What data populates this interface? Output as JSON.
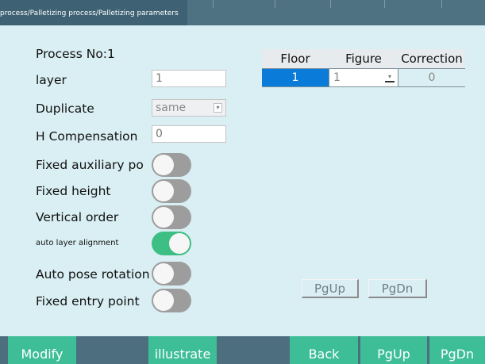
{
  "breadcrumb": "process/Palletizing process/Palletizing parameters",
  "process_no": "Process No:1",
  "fields": {
    "layer": {
      "label": "layer",
      "value": "1"
    },
    "duplicate": {
      "label": "Duplicate",
      "value": "same"
    },
    "h_compensation": {
      "label": "H Compensation",
      "value": "0"
    }
  },
  "toggles": [
    {
      "label": "Fixed auxiliary point",
      "on": false
    },
    {
      "label": "Fixed height",
      "on": false
    },
    {
      "label": "Vertical order",
      "on": false
    },
    {
      "label": "auto layer alignment",
      "on": true
    },
    {
      "label": "Auto pose rotation",
      "on": false
    },
    {
      "label": "Fixed entry point",
      "on": false
    }
  ],
  "table": {
    "headers": [
      "Floor",
      "Figure",
      "Correction"
    ],
    "row": {
      "floor": "1",
      "figure": "1",
      "correction": "0"
    }
  },
  "pager": {
    "pgup": "PgUp",
    "pgdn": "PgDn"
  },
  "bottom_buttons": {
    "modify": "Modify",
    "illustrate": "illustrate",
    "back": "Back",
    "pgup": "PgUp",
    "pgdn": "PgDn"
  },
  "colors": {
    "background": "#d9eff3",
    "header": "#4f7282",
    "accent_green": "#3dbe96",
    "toggle_on": "#3dbe82",
    "toggle_off": "#9d9d9d",
    "selected_cell": "#0a7bd9"
  },
  "icons": {
    "dropdown": "chevron-down-icon"
  }
}
